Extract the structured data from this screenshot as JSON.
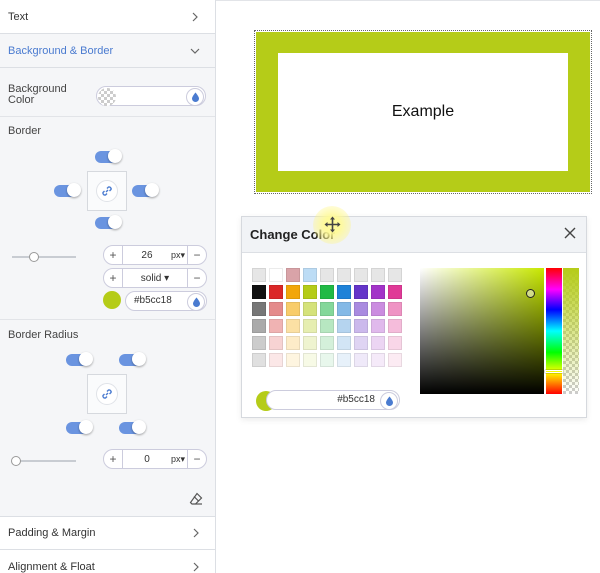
{
  "panel": {
    "text_section": "Text",
    "bg_border_section": "Background & Border",
    "bg_color_label_line1": "Background",
    "bg_color_label_line2": "Color",
    "border_label": "Border",
    "border_width": "26",
    "border_unit": "px",
    "border_style": "solid",
    "border_color_hex": "#b5cc18",
    "border_radius_label": "Border Radius",
    "radius_value": "0",
    "radius_unit": "px",
    "padding_section": "Padding & Margin",
    "alignment_section": "Alignment & Float",
    "plus": "+",
    "minus": "−",
    "dropdown_caret": "▾"
  },
  "preview": {
    "text": "Example",
    "border_color": "#b5cc18"
  },
  "dialog": {
    "title": "Change Color",
    "hex_value": "#b5cc18",
    "current_color": "#b5cc18",
    "palette": [
      [
        "#e6e6e6",
        "#ffffff",
        "#d9a3a8",
        "#bcdcf5",
        "#e6e6e6",
        "#e6e6e6",
        "#e6e6e6",
        "#e6e6e6",
        "#e6e6e6"
      ],
      [
        "#111111",
        "#db2828",
        "#f2a60a",
        "#b5cc18",
        "#21ba45",
        "#1e82d8",
        "#6435c9",
        "#a333c8",
        "#e03997"
      ],
      [
        "#777777",
        "#e48b8b",
        "#f8cc6a",
        "#d5e27a",
        "#84d79a",
        "#84b9e6",
        "#a98be0",
        "#cb8ce0",
        "#ef93c4"
      ],
      [
        "#aaaaaa",
        "#f0b3b3",
        "#fbe0a4",
        "#e6eeb0",
        "#b7e7c1",
        "#b5d4ef",
        "#cbb9ec",
        "#e0b9ec",
        "#f5bcdb"
      ],
      [
        "#cccccc",
        "#f7d3d3",
        "#fdecc8",
        "#eff4d0",
        "#d4f0da",
        "#d2e5f5",
        "#dfd4f3",
        "#ecd5f3",
        "#f9d6e8"
      ],
      [
        "#e0e0e0",
        "#fbe7e7",
        "#fef5e0",
        "#f7fae6",
        "#e8f7ec",
        "#e7f1fa",
        "#efe9f9",
        "#f5eaf9",
        "#fcebf3"
      ]
    ]
  }
}
